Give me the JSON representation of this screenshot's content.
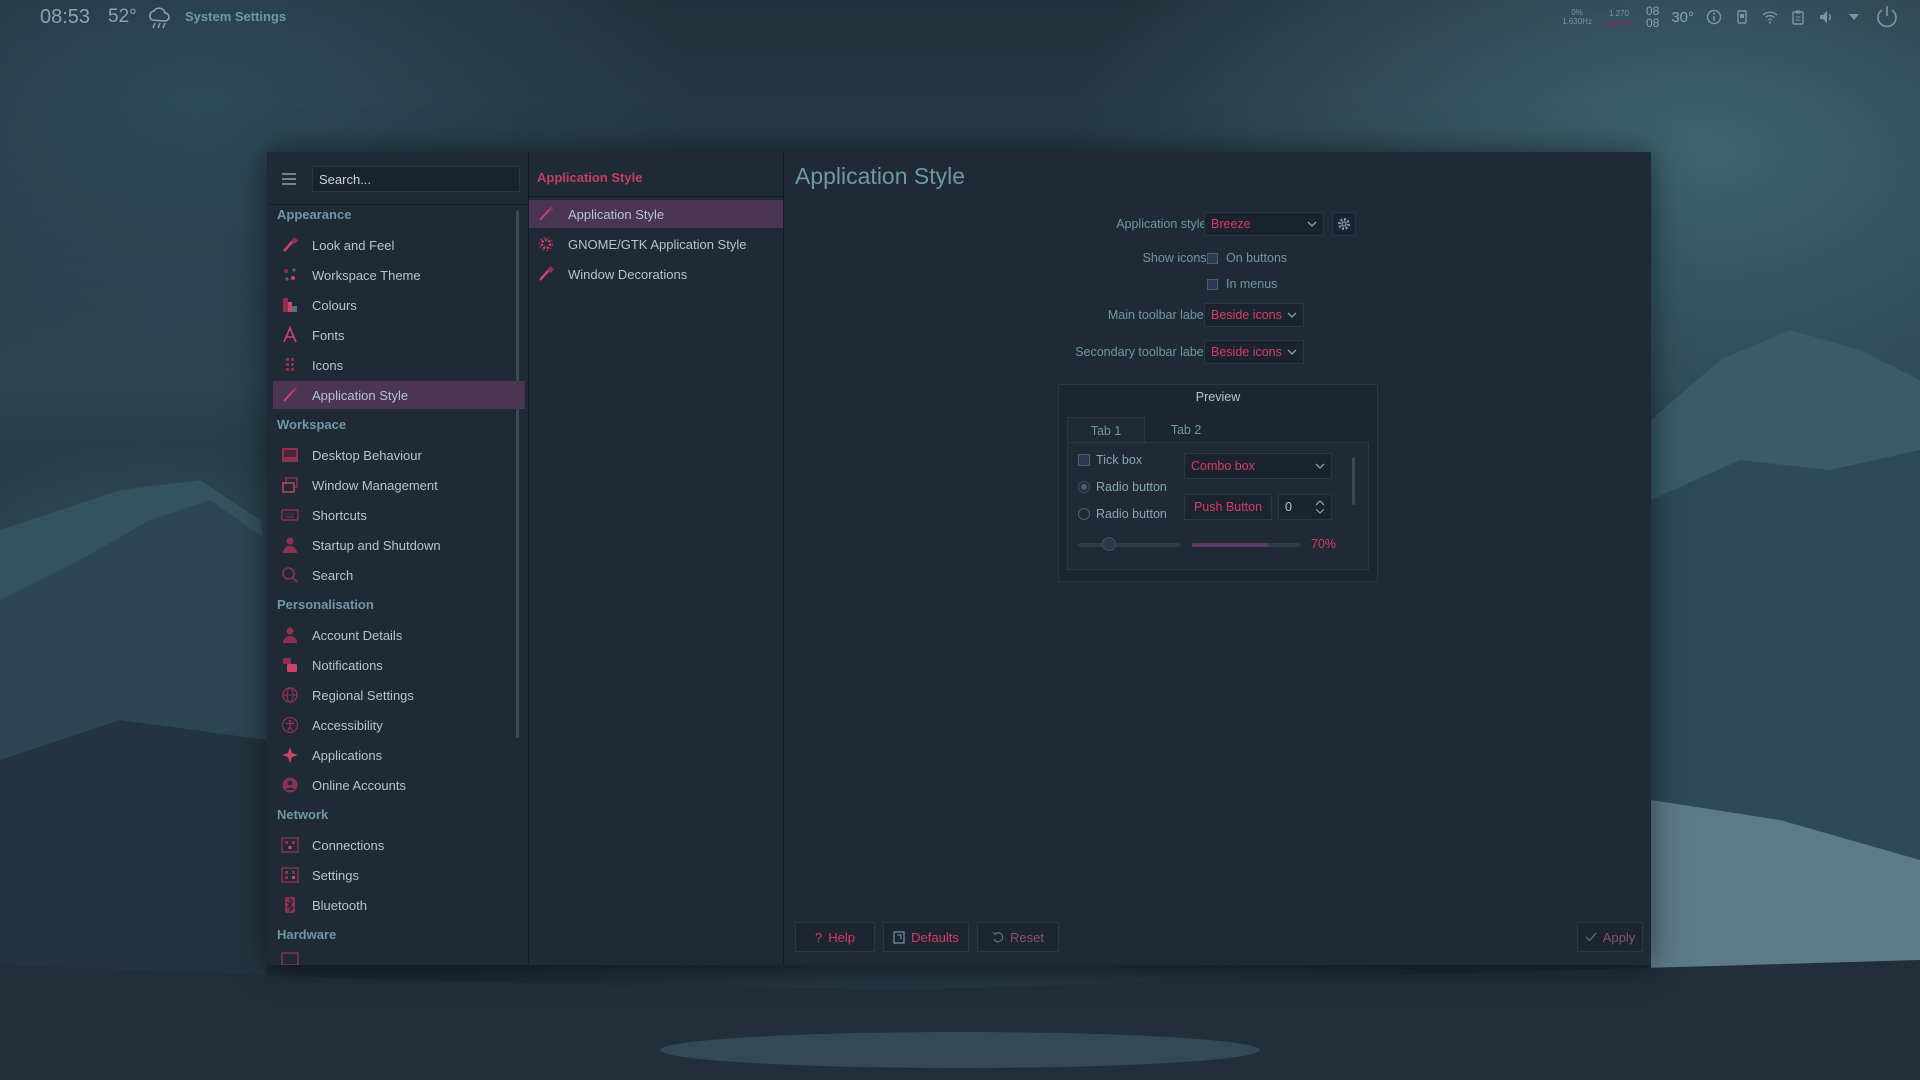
{
  "panel": {
    "time": "08:53",
    "temperature": "52°",
    "active_app": "System Settings",
    "tray": {
      "net_line1": "0%",
      "net_line2": "1.630Hz",
      "net_line3": "1.270",
      "date_top": "08",
      "date_bottom": "08",
      "cpu_temp": "30°"
    }
  },
  "sidebar": {
    "search_placeholder": "Search...",
    "sections": [
      {
        "title": "Appearance",
        "items": [
          "Look and Feel",
          "Workspace Theme",
          "Colours",
          "Fonts",
          "Icons",
          "Application Style"
        ]
      },
      {
        "title": "Workspace",
        "items": [
          "Desktop Behaviour",
          "Window Management",
          "Shortcuts",
          "Startup and Shutdown",
          "Search"
        ]
      },
      {
        "title": "Personalisation",
        "items": [
          "Account Details",
          "Notifications",
          "Regional Settings",
          "Accessibility",
          "Applications",
          "Online Accounts"
        ]
      },
      {
        "title": "Network",
        "items": [
          "Connections",
          "Settings",
          "Bluetooth"
        ]
      },
      {
        "title": "Hardware",
        "items": []
      }
    ],
    "selected": "Application Style"
  },
  "subnav": {
    "header": "Application Style",
    "items": [
      "Application Style",
      "GNOME/GTK Application Style",
      "Window Decorations"
    ],
    "selected": "Application Style"
  },
  "main": {
    "title": "Application Style",
    "app_style_label": "Application style:",
    "app_style_value": "Breeze",
    "show_icons_label": "Show icons:",
    "on_buttons": "On buttons",
    "in_menus": "In menus",
    "main_toolbar_label": "Main toolbar label:",
    "main_toolbar_value": "Beside icons",
    "secondary_toolbar_label": "Secondary toolbar label:",
    "secondary_toolbar_value": "Beside icons",
    "preview": {
      "title": "Preview",
      "tab1": "Tab 1",
      "tab2": "Tab 2",
      "tick_box": "Tick box",
      "radio1": "Radio button",
      "radio2": "Radio button",
      "combo_box": "Combo box",
      "push_button": "Push Button",
      "spin_value": "0",
      "slider_value": 0.3,
      "progress_value": 0.7,
      "progress_text": "70%"
    }
  },
  "footer": {
    "help": "Help",
    "defaults": "Defaults",
    "reset": "Reset",
    "apply": "Apply"
  },
  "colors": {
    "accent": "#d33e68",
    "selection": "#4b3454",
    "heading": "#6f97a6",
    "window_bg": "#1f2a35"
  }
}
